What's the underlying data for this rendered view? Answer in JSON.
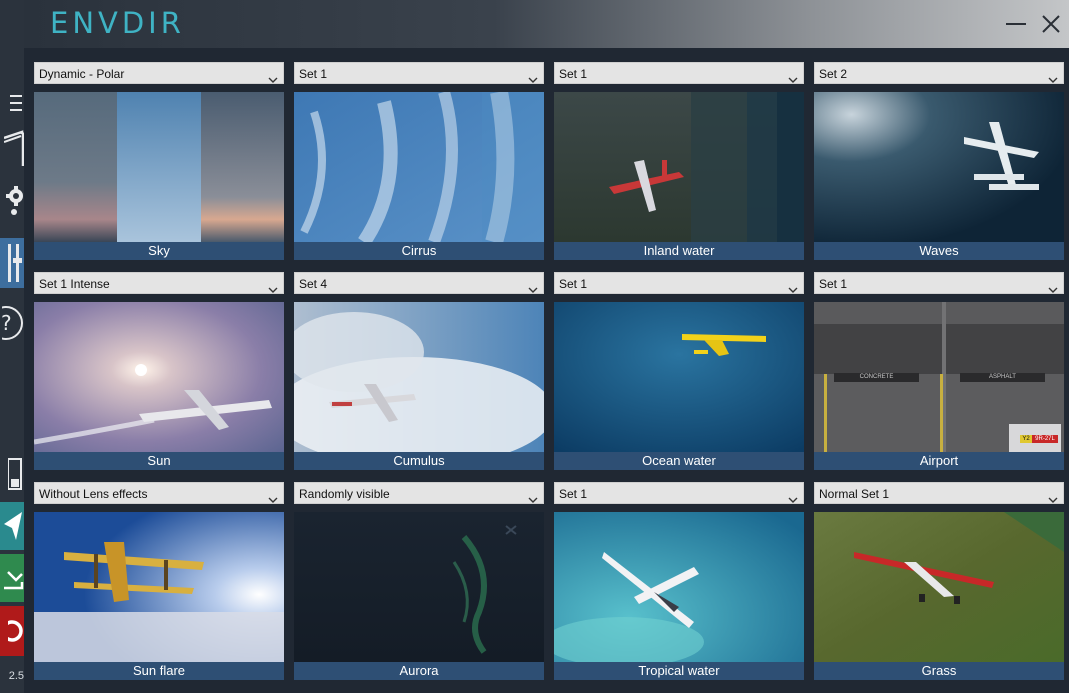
{
  "app": {
    "title": "ENVDIR",
    "version": "2.5"
  },
  "window": {
    "minimize_icon": "minimize-icon",
    "close_icon": "close-icon"
  },
  "sidebar": {
    "items": [
      {
        "icon": "menu-icon"
      },
      {
        "icon": "home-icon"
      },
      {
        "icon": "gear-icon"
      },
      {
        "icon": "sliders-icon",
        "active": true
      },
      {
        "icon": "help-icon"
      },
      {
        "icon": "save-icon"
      },
      {
        "icon": "send-icon"
      },
      {
        "icon": "download-icon"
      },
      {
        "icon": "power-icon"
      }
    ]
  },
  "colors": {
    "accent": "#3fb3c4",
    "caption_bg": "#2e4f74",
    "send_bg": "#2a8a8e",
    "download_bg": "#2f8a4e",
    "power_bg": "#b01a1a"
  },
  "cells": [
    {
      "select": "Dynamic - Polar",
      "label": "Sky"
    },
    {
      "select": "Set 1",
      "label": "Cirrus"
    },
    {
      "select": "Set 1",
      "label": "Inland water"
    },
    {
      "select": "Set 2",
      "label": "Waves"
    },
    {
      "select": "Set 1 Intense",
      "label": "Sun"
    },
    {
      "select": "Set 4",
      "label": "Cumulus"
    },
    {
      "select": "Set 1",
      "label": "Ocean water"
    },
    {
      "select": "Set 1",
      "label": "Airport"
    },
    {
      "select": "Without Lens effects",
      "label": "Sun flare"
    },
    {
      "select": "Randomly visible",
      "label": "Aurora"
    },
    {
      "select": "Set 1",
      "label": "Tropical water"
    },
    {
      "select": "Normal Set 1",
      "label": "Grass"
    }
  ],
  "airport_signs": {
    "concrete": "CONCRETE",
    "asphalt": "ASPHALT",
    "runway_sign_a": "Y2",
    "runway_sign_b": "9R-27L"
  }
}
